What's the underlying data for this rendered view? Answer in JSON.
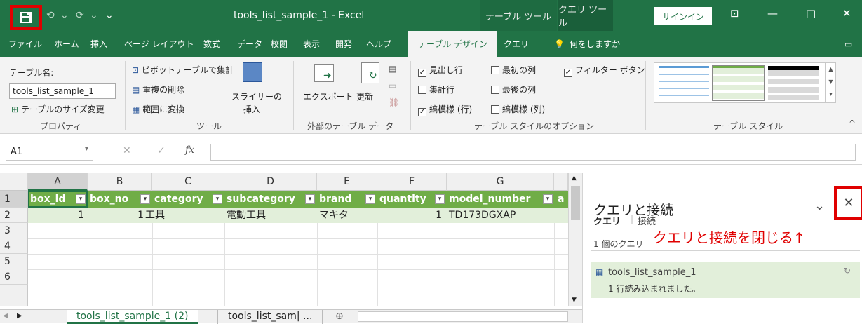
{
  "titlebar": {
    "title": "tools_list_sample_1  -  Excel",
    "ctx_table": "テーブル ツール",
    "ctx_query": "クエリ ツール",
    "signin": "サインイン",
    "restore": "⊡",
    "minimize": "—",
    "maximize": "□",
    "close": "✕",
    "undo": "⟲",
    "undo_dd": "⌄",
    "redo": "⟳",
    "redo_dd": "⌄",
    "customize": "⌄"
  },
  "tabs": [
    "ファイル",
    "ホーム",
    "挿入",
    "ページ レイアウト",
    "数式",
    "データ",
    "校閲",
    "表示",
    "開発",
    "ヘルプ",
    "テーブル デザイン",
    "クエリ"
  ],
  "tellme": "何をしますか",
  "ribbon": {
    "table_name_label": "テーブル名:",
    "table_name": "tools_list_sample_1",
    "resize": "テーブルのサイズ変更",
    "group_props": "プロパティ",
    "pivot": "ピボットテーブルで集計",
    "dedupe": "重複の削除",
    "to_range": "範囲に変換",
    "slicer1": "スライサーの",
    "slicer2": "挿入",
    "group_tools": "ツール",
    "export": "エクスポート",
    "refresh": "更新",
    "group_ext": "外部のテーブル データ",
    "opt_header": "見出し行",
    "opt_total": "集計行",
    "opt_banded_rows": "縞模様 (行)",
    "opt_first": "最初の列",
    "opt_last": "最後の列",
    "opt_banded_cols": "縞模様 (列)",
    "opt_filter": "フィルター ボタン",
    "group_opts": "テーブル スタイルのオプション",
    "group_styles": "テーブル スタイル",
    "check": "✓"
  },
  "formula": {
    "namebox": "A1",
    "cancel": "✕",
    "enter": "✓",
    "fx": "fx"
  },
  "grid": {
    "col_letters": [
      "A",
      "B",
      "C",
      "D",
      "E",
      "F",
      "G"
    ],
    "row_numbers": [
      "1",
      "2",
      "3",
      "4",
      "5",
      "6"
    ],
    "headers": [
      "box_id",
      "box_no",
      "category",
      "subcategory",
      "brand",
      "quantity",
      "model_number",
      "a"
    ],
    "row2": [
      "1",
      "1",
      "工具",
      "電動工具",
      "マキタ",
      "1",
      "TD173DGXAP"
    ],
    "filter_glyph": "▾"
  },
  "sheets": {
    "tab1": "tools_list_sample_1 (2)",
    "tab2": "tools_list_sam| ...",
    "add": "⊕",
    "nav_left": "◀",
    "nav_right": "▶"
  },
  "pane": {
    "title": "クエリと接続",
    "close_glyph": "✕",
    "collapse_glyph": "⌄",
    "tab_query": "クエリ",
    "tab_conn": "接続",
    "annotation": "クエリと接続を閉じる↑",
    "count": "1 個のクエリ",
    "query_name": "tools_list_sample_1",
    "query_status": "1 行読み込まれました。"
  }
}
